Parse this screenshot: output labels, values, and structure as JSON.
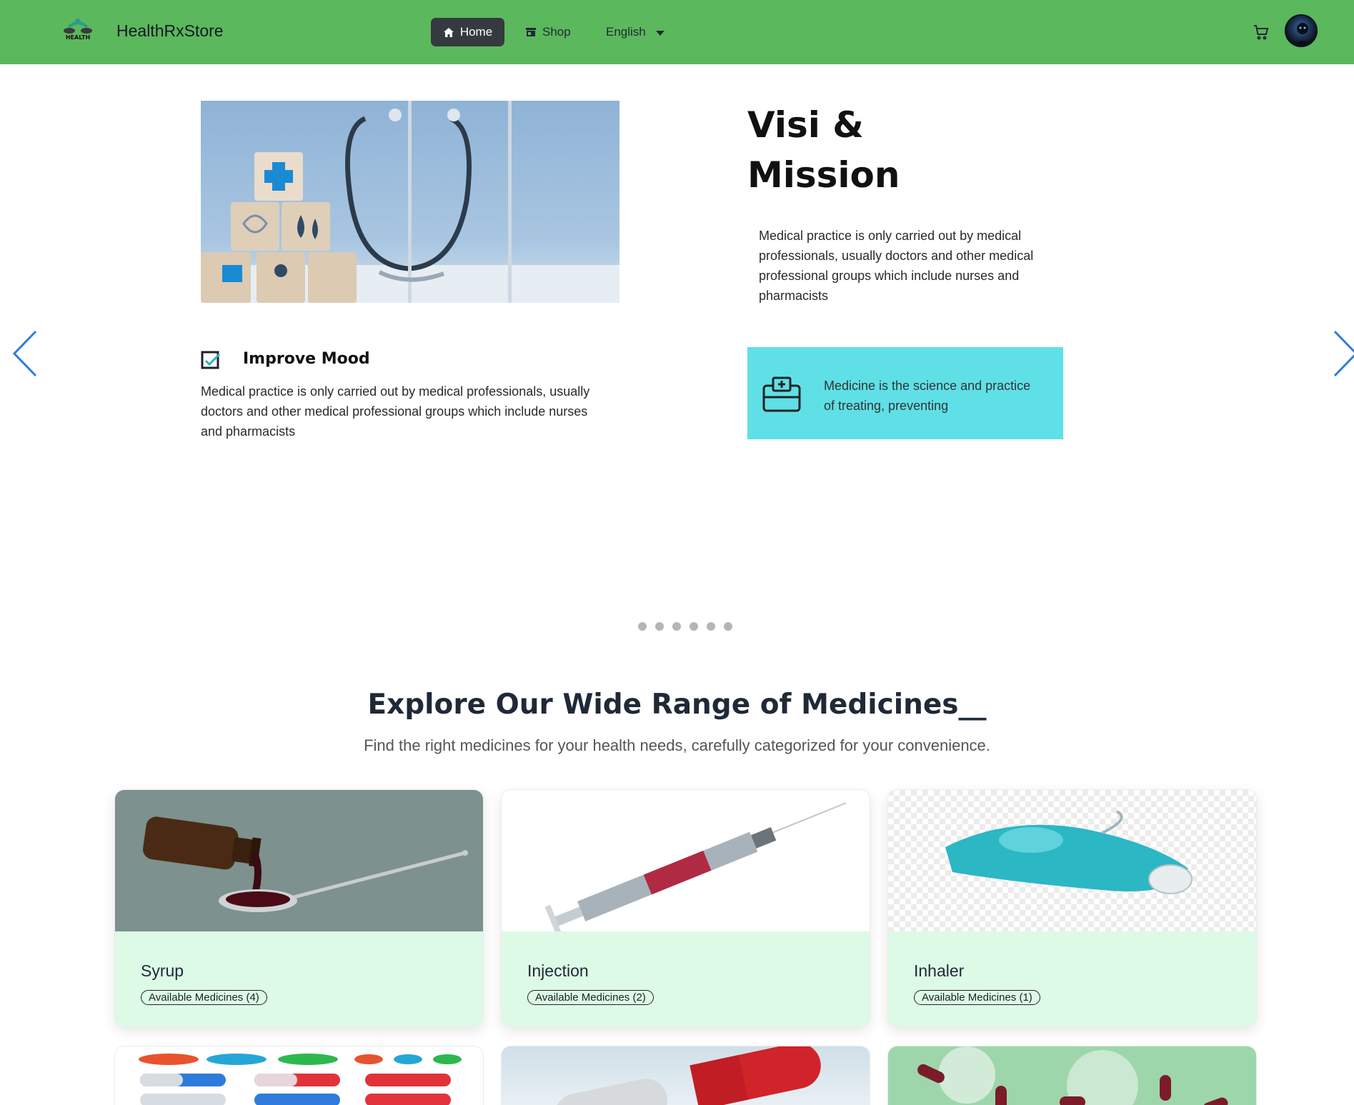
{
  "navbar": {
    "brand": "HealthRxStore",
    "logo_text": "HEALTH",
    "home_label": "Home",
    "shop_label": "Shop",
    "language": "English",
    "bg_color": "#5cb85c"
  },
  "hero": {
    "mission_title_line1": "Visi &",
    "mission_title_line2": "Mission",
    "mission_text": "Medical practice is only carried out by medical professionals, usually doctors and other medical professional groups which include nurses and pharmacists",
    "mood_title": "Improve Mood",
    "mood_text": "Medical practice is only carried out by medical professionals, usually doctors and other medical professional groups which include nurses and pharmacists",
    "callout_text": "Medicine is the science and practice of treating, preventing",
    "callout_color": "#5fe0e6",
    "slide_count": 6
  },
  "section": {
    "title": "Explore Our Wide Range of Medicines__",
    "subtitle": "Find the right medicines for your health needs, carefully categorized for your convenience."
  },
  "categories": [
    {
      "name": "Syrup",
      "badge": "Available Medicines (4)"
    },
    {
      "name": "Injection",
      "badge": "Available Medicines (2)"
    },
    {
      "name": "Inhaler",
      "badge": "Available Medicines (1)"
    }
  ]
}
